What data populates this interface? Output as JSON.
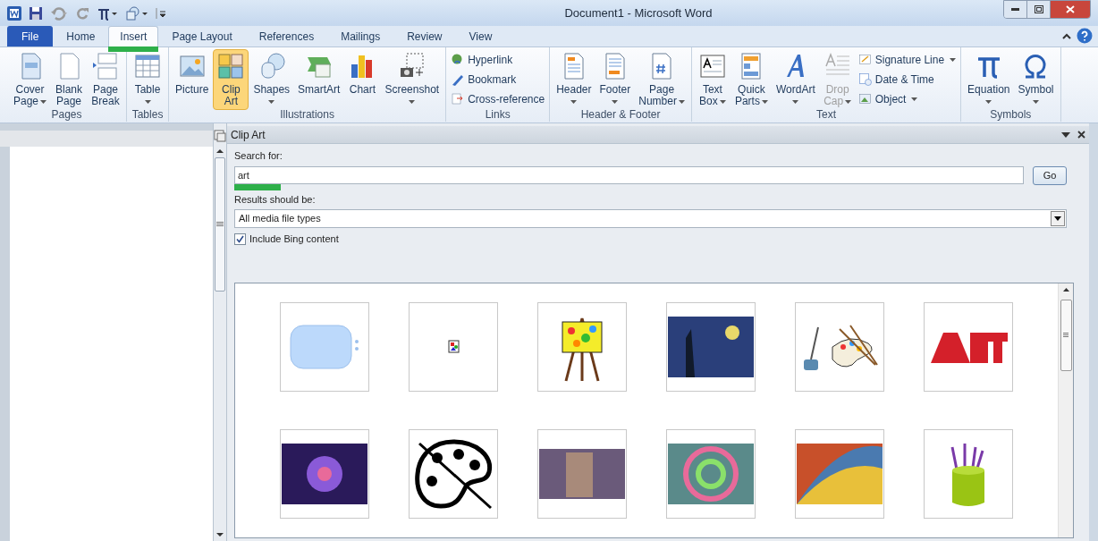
{
  "window": {
    "title": "Document1 - Microsoft Word"
  },
  "tabs": [
    {
      "label": "File",
      "kind": "file",
      "selected": false
    },
    {
      "label": "Home",
      "kind": "tab",
      "selected": false
    },
    {
      "label": "Insert",
      "kind": "tab",
      "selected": true
    },
    {
      "label": "Page Layout",
      "kind": "tab",
      "selected": false
    },
    {
      "label": "References",
      "kind": "tab",
      "selected": false
    },
    {
      "label": "Mailings",
      "kind": "tab",
      "selected": false
    },
    {
      "label": "Review",
      "kind": "tab",
      "selected": false
    },
    {
      "label": "View",
      "kind": "tab",
      "selected": false
    }
  ],
  "ribbon": [
    {
      "name": "Pages",
      "items": [
        {
          "kind": "large",
          "lines": [
            "Cover",
            "Page"
          ],
          "dropdown": true,
          "selected": false,
          "disabled": false
        },
        {
          "kind": "large",
          "lines": [
            "Blank",
            "Page"
          ],
          "dropdown": false,
          "selected": false,
          "disabled": false
        },
        {
          "kind": "large",
          "lines": [
            "Page",
            "Break"
          ],
          "dropdown": false,
          "selected": false,
          "disabled": false
        }
      ]
    },
    {
      "name": "Tables",
      "items": [
        {
          "kind": "large",
          "lines": [
            "Table"
          ],
          "dropdown": true,
          "selected": false,
          "disabled": false
        }
      ]
    },
    {
      "name": "Illustrations",
      "items": [
        {
          "kind": "large",
          "lines": [
            "Picture"
          ],
          "dropdown": false,
          "selected": false,
          "disabled": false
        },
        {
          "kind": "large",
          "lines": [
            "Clip",
            "Art"
          ],
          "dropdown": false,
          "selected": true,
          "disabled": false
        },
        {
          "kind": "large",
          "lines": [
            "Shapes"
          ],
          "dropdown": true,
          "selected": false,
          "disabled": false
        },
        {
          "kind": "large",
          "lines": [
            "SmartArt"
          ],
          "dropdown": false,
          "selected": false,
          "disabled": false
        },
        {
          "kind": "large",
          "lines": [
            "Chart"
          ],
          "dropdown": false,
          "selected": false,
          "disabled": false
        },
        {
          "kind": "large",
          "lines": [
            "Screenshot"
          ],
          "dropdown": true,
          "selected": false,
          "disabled": false
        }
      ]
    },
    {
      "name": "Links",
      "items": [
        {
          "kind": "small",
          "lines": [
            "Hyperlink"
          ],
          "dropdown": false,
          "selected": false,
          "disabled": false
        },
        {
          "kind": "small",
          "lines": [
            "Bookmark"
          ],
          "dropdown": false,
          "selected": false,
          "disabled": false
        },
        {
          "kind": "small",
          "lines": [
            "Cross-reference"
          ],
          "dropdown": false,
          "selected": false,
          "disabled": false
        }
      ]
    },
    {
      "name": "Header & Footer",
      "items": [
        {
          "kind": "large",
          "lines": [
            "Header"
          ],
          "dropdown": true,
          "selected": false,
          "disabled": false
        },
        {
          "kind": "large",
          "lines": [
            "Footer"
          ],
          "dropdown": true,
          "selected": false,
          "disabled": false
        },
        {
          "kind": "large",
          "lines": [
            "Page",
            "Number"
          ],
          "dropdown": true,
          "selected": false,
          "disabled": false
        }
      ]
    },
    {
      "name": "Text",
      "items": [
        {
          "kind": "large",
          "lines": [
            "Text",
            "Box"
          ],
          "dropdown": true,
          "selected": false,
          "disabled": false
        },
        {
          "kind": "large",
          "lines": [
            "Quick",
            "Parts"
          ],
          "dropdown": true,
          "selected": false,
          "disabled": false
        },
        {
          "kind": "large",
          "lines": [
            "WordArt"
          ],
          "dropdown": true,
          "selected": false,
          "disabled": false
        },
        {
          "kind": "large",
          "lines": [
            "Drop",
            "Cap"
          ],
          "dropdown": true,
          "selected": false,
          "disabled": true
        },
        {
          "kind": "small",
          "lines": [
            "Signature Line"
          ],
          "dropdown": true,
          "selected": false,
          "disabled": false
        },
        {
          "kind": "small",
          "lines": [
            "Date & Time"
          ],
          "dropdown": false,
          "selected": false,
          "disabled": false
        },
        {
          "kind": "small",
          "lines": [
            "Object"
          ],
          "dropdown": true,
          "selected": false,
          "disabled": false
        }
      ]
    },
    {
      "name": "Symbols",
      "items": [
        {
          "kind": "large",
          "lines": [
            "Equation"
          ],
          "dropdown": true,
          "selected": false,
          "disabled": false
        },
        {
          "kind": "large",
          "lines": [
            "Symbol"
          ],
          "dropdown": true,
          "selected": false,
          "disabled": false
        }
      ]
    }
  ],
  "pane": {
    "title": "Clip Art",
    "search_label": "Search for:",
    "search_value": "art",
    "go": "Go",
    "results_label": "Results should be:",
    "results_value": "All media file types",
    "bing": {
      "label": "Include Bing content",
      "checked": true
    }
  }
}
